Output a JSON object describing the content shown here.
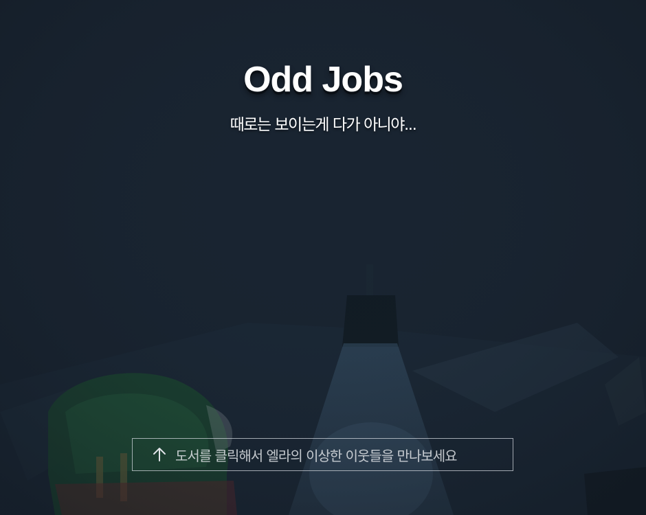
{
  "title": "Odd Jobs",
  "subtitle": "때로는 보이는게 다가 아니야...",
  "hint": {
    "icon": "arrow-up-icon",
    "text": "도서를 클릭해서 엘라의 이상한 이웃들을 만나보세요"
  },
  "colors": {
    "background": "#192431",
    "text": "#ffffff"
  }
}
